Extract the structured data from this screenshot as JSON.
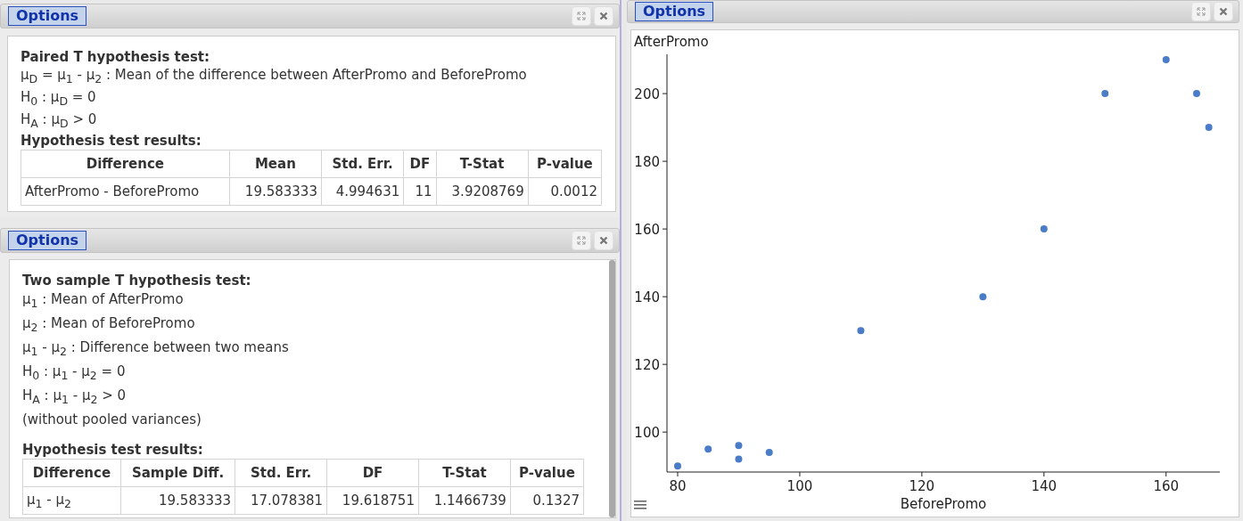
{
  "panels": [
    {
      "kind": "paired",
      "options_button": "Options",
      "title": "Paired T hypothesis test:",
      "lines": [
        "μ$_{D}$ = μ$_{1}$ - μ$_{2}$ : Mean of the difference between AfterPromo and BeforePromo",
        "H$_{0}$ : μ$_{D}$ = 0",
        "H$_{A}$ : μ$_{D}$ > 0"
      ],
      "results_title": "Hypothesis test results:",
      "table": {
        "columns": [
          "Difference",
          "Mean",
          "Std. Err.",
          "DF",
          "T-Stat",
          "P-value"
        ],
        "rows": [
          [
            "AfterPromo - BeforePromo",
            "19.583333",
            "4.994631",
            "11",
            "3.9208769",
            "0.0012"
          ]
        ]
      }
    },
    {
      "kind": "two_sample",
      "options_button": "Options",
      "title": "Two sample T hypothesis test:",
      "lines": [
        "μ$_{1}$ : Mean of AfterPromo",
        "μ$_{2}$ : Mean of BeforePromo",
        "μ$_{1}$ - μ$_{2}$ : Difference between two means",
        "H$_{0}$ : μ$_{1}$ - μ$_{2}$ = 0",
        "H$_{A}$ : μ$_{1}$ - μ$_{2}$ > 0",
        "(without pooled variances)"
      ],
      "results_title": "Hypothesis test results:",
      "table": {
        "columns": [
          "Difference",
          "Sample Diff.",
          "Std. Err.",
          "DF",
          "T-Stat",
          "P-value"
        ],
        "rows": [
          [
            "μ$_{1}$ - μ$_{2}$",
            "19.583333",
            "17.078381",
            "19.618751",
            "1.1466739",
            "0.1327"
          ]
        ]
      }
    },
    {
      "kind": "chart",
      "options_button": "Options",
      "chart_data": {
        "type": "scatter",
        "xlabel": "BeforePromo",
        "ylabel": "AfterPromo",
        "x": [
          80,
          85,
          90,
          90,
          95,
          110,
          130,
          140,
          150,
          160,
          165,
          167
        ],
        "series": [
          {
            "color": "#4a7cc7",
            "values": [
              90,
              95,
              96,
              92,
              94,
              130,
              140,
              160,
              200,
              210,
              200,
              190
            ]
          }
        ],
        "xlim": [
          78.25,
          168.8
        ],
        "ylim": [
          88.2,
          211.6
        ],
        "xticks": [
          80,
          100,
          120,
          140,
          160
        ],
        "yticks": [
          100,
          120,
          140,
          160,
          180,
          200
        ]
      }
    }
  ]
}
